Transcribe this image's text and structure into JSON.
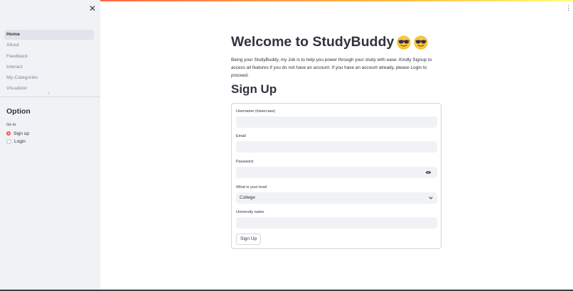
{
  "sidebar": {
    "close_icon": "close-icon",
    "nav_items": [
      {
        "label": "Home",
        "active": true
      },
      {
        "label": "About",
        "active": false
      },
      {
        "label": "Feedback",
        "active": false
      },
      {
        "label": "Interact",
        "active": false
      },
      {
        "label": "My-Categories",
        "active": false
      },
      {
        "label": "Visualizer",
        "active": false
      }
    ],
    "option_title": "Option",
    "goto_label": "Go to",
    "radio_options": [
      {
        "label": "Sign up",
        "checked": true
      },
      {
        "label": "Login",
        "checked": false
      }
    ]
  },
  "header": {
    "menu_icon": "more-vertical-icon"
  },
  "main": {
    "title": "Welcome to StudyBuddy",
    "title_emojis": [
      "sunglasses-face-icon",
      "sunglasses-face-icon"
    ],
    "intro": "Being your StudyBuddy, my Job is to help you power through your study with ease. Kindly Signup to access all features if you do not have an account. If you have an account already, please Login to proceed.",
    "signup_heading": "Sign Up"
  },
  "form": {
    "username_label": "Username (lowercase)",
    "username_value": "",
    "email_label": "Email",
    "email_value": "",
    "password_label": "Password",
    "password_value": "",
    "level_label": "What is your level",
    "level_value": "College",
    "university_label": "University name",
    "university_value": "",
    "submit_label": "Sign Up"
  },
  "colors": {
    "accent": "#ff4b4b",
    "sidebar_bg": "#f0f2f6",
    "input_bg": "#f0f2f6",
    "text": "#31333f",
    "muted_text": "#808495"
  }
}
